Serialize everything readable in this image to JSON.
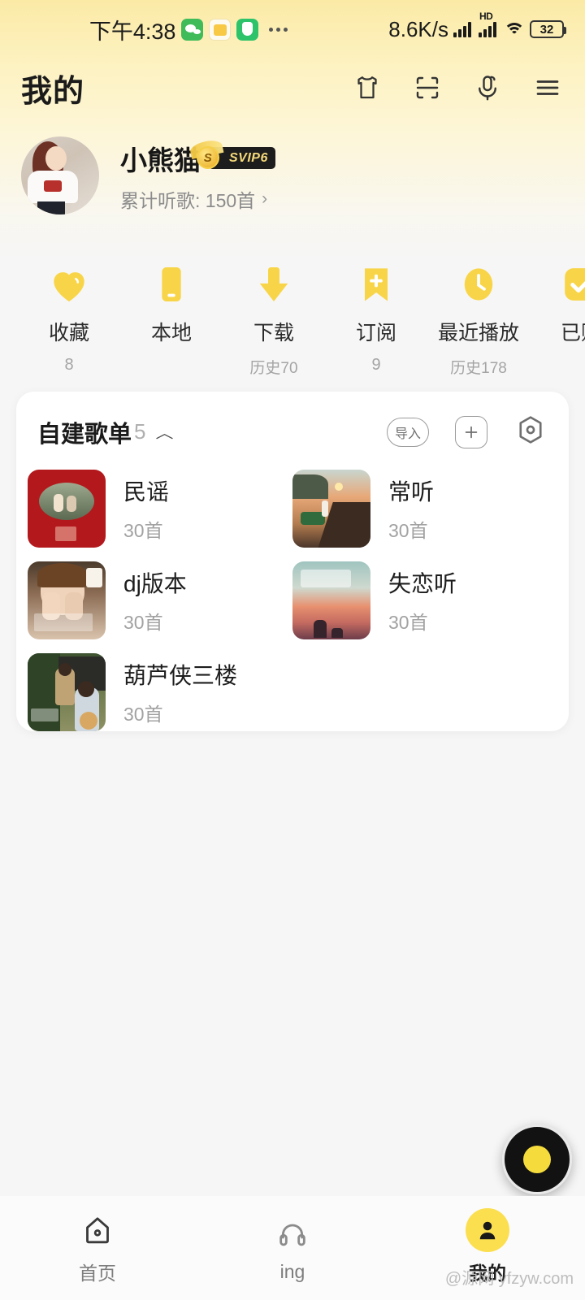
{
  "status_bar": {
    "time": "下午4:38",
    "network_speed": "8.6K/s",
    "hd_label": "HD",
    "battery": "32",
    "app_icons": [
      "wechat-icon",
      "game-icon",
      "security-icon"
    ],
    "overflow": "more-dots-icon"
  },
  "header": {
    "title": "我的",
    "icons": [
      "tshirt-skin-icon",
      "scan-icon",
      "voice-search-icon",
      "menu-icon"
    ]
  },
  "profile": {
    "name": "小熊猫",
    "vip_badge": "SVIP6",
    "vip_coin": "S",
    "listen_stat": "累计听歌: 150首",
    "chevron": "›"
  },
  "quick_actions": [
    {
      "label": "收藏",
      "sub": "8",
      "icon": "heart-icon"
    },
    {
      "label": "本地",
      "sub": "",
      "icon": "phone-icon"
    },
    {
      "label": "下载",
      "sub": "历史70",
      "icon": "download-icon"
    },
    {
      "label": "订阅",
      "sub": "9",
      "icon": "bookmark-plus-icon"
    },
    {
      "label": "最近播放",
      "sub": "历史178",
      "icon": "clock-icon"
    },
    {
      "label": "已购",
      "sub": "",
      "icon": "check-icon"
    }
  ],
  "playlist_card": {
    "title": "自建歌单",
    "count": "5",
    "chevron": "︿",
    "actions": {
      "import_label": "导入",
      "add_label": "＋",
      "settings_label": "◎"
    },
    "items": [
      {
        "name": "民谣",
        "songs": "30首",
        "cover": "cov-minyao"
      },
      {
        "name": "常听",
        "songs": "30首",
        "cover": "cov-changting"
      },
      {
        "name": "dj版本",
        "songs": "30首",
        "cover": "cov-dj"
      },
      {
        "name": "失恋听",
        "songs": "30首",
        "cover": "cov-shilian"
      },
      {
        "name": "葫芦侠三楼",
        "songs": "30首",
        "cover": "cov-hulu"
      }
    ]
  },
  "mini_player": {
    "icon": "vinyl-disc-icon"
  },
  "bottom_nav": [
    {
      "label": "首页",
      "icon": "home-icon",
      "active": false
    },
    {
      "label": "ing",
      "icon": "headphones-icon",
      "active": false
    },
    {
      "label": "我的",
      "icon": "person-icon",
      "active": true
    }
  ],
  "watermark": "@源网 yfzyw.com",
  "colors": {
    "accent_yellow": "#F8D548",
    "header_gradient_top": "#FBEAA6",
    "page_bg": "#F6F6F6",
    "card_bg": "#FFFFFF"
  }
}
